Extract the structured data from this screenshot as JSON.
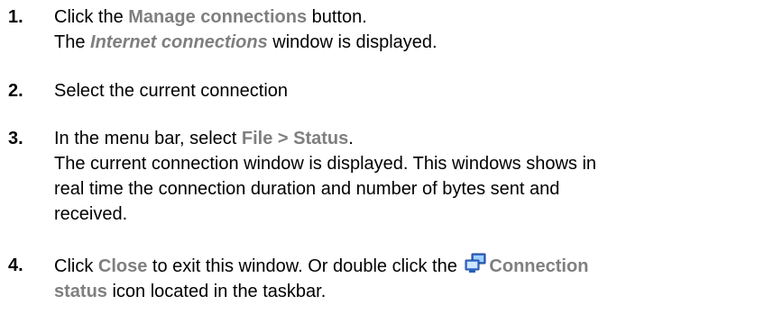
{
  "steps": [
    {
      "number": "1.",
      "l1_pre": "Click the ",
      "l1_ui": "Manage connections",
      "l1_post": " button.",
      "l2_ui": "Internet connections",
      "l2_post": " window is displayed.",
      "l2_pre": "The "
    },
    {
      "number": "2.",
      "text": "Select the current connection"
    },
    {
      "number": "3.",
      "l1_pre": "In the menu bar, select ",
      "l1_ui": "File > Status",
      "l1_post": ".",
      "l2": "The current connection window is displayed. This windows shows in",
      "l3": "real time the connection duration and number of bytes sent and",
      "l4": "received."
    },
    {
      "number": "4.",
      "l1_pre": "Click ",
      "l1_ui": "Close",
      "l1_mid": " to exit this window. Or double click the ",
      "l1_ui2": "Connection",
      "l2_ui": "status",
      "l2_post": " icon located in the taskbar.",
      "icon": "network-computers-icon"
    }
  ]
}
